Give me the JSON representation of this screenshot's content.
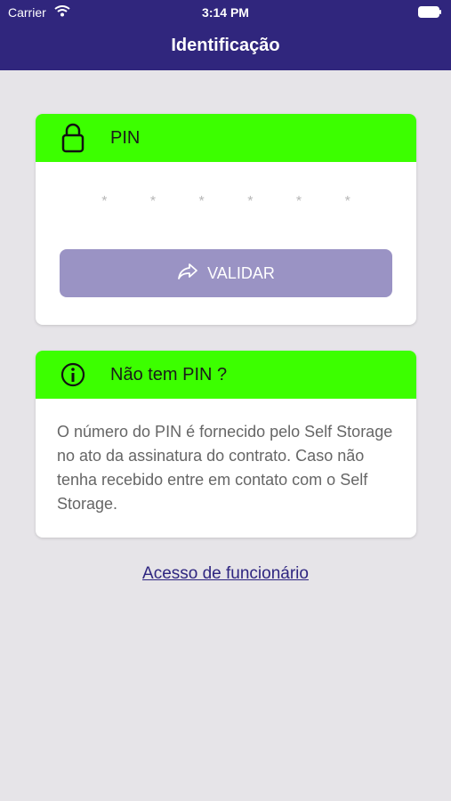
{
  "status_bar": {
    "carrier": "Carrier",
    "time": "3:14 PM"
  },
  "nav": {
    "title": "Identificação"
  },
  "pin_card": {
    "header": "PIN",
    "pin_placeholder": "* * * * * *",
    "button_label": "VALIDAR",
    "colors": {
      "header": "#3cff00",
      "button": "#9a93c4"
    }
  },
  "info_card": {
    "header": "Não tem PIN ?",
    "body": "O número do PIN é fornecido pelo Self Storage no ato da assinatura do contrato. Caso não tenha recebido entre em contato com o Self Storage."
  },
  "footer_link": "Acesso de funcionário",
  "icons": [
    "wifi-icon",
    "battery-icon",
    "lock-icon",
    "share-arrow-icon",
    "info-icon"
  ],
  "colors": {
    "nav": "#30267d",
    "background": "#e6e4e8",
    "link": "#2e2580"
  }
}
